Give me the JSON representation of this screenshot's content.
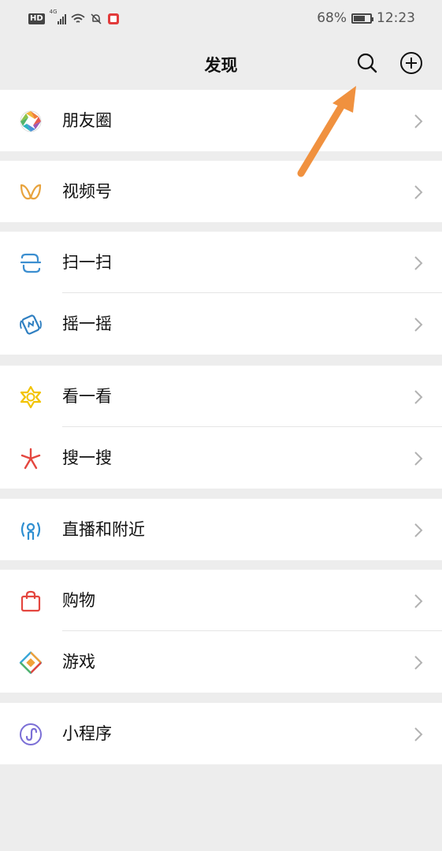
{
  "status_bar": {
    "network_badge": "HD",
    "network_type": "4G",
    "battery_percent": "68%",
    "battery_level": 0.68,
    "time": "12:23"
  },
  "nav": {
    "title": "发现",
    "search_icon": "search-icon",
    "add_icon": "plus-circle-icon"
  },
  "groups": [
    {
      "items": [
        {
          "label": "朋友圈",
          "icon": "moments-icon"
        }
      ]
    },
    {
      "items": [
        {
          "label": "视频号",
          "icon": "channels-icon"
        }
      ]
    },
    {
      "items": [
        {
          "label": "扫一扫",
          "icon": "scan-icon"
        },
        {
          "label": "摇一摇",
          "icon": "shake-icon"
        }
      ]
    },
    {
      "items": [
        {
          "label": "看一看",
          "icon": "top-stories-icon"
        },
        {
          "label": "搜一搜",
          "icon": "search-discover-icon"
        }
      ]
    },
    {
      "items": [
        {
          "label": "直播和附近",
          "icon": "live-nearby-icon"
        }
      ]
    },
    {
      "items": [
        {
          "label": "购物",
          "icon": "shopping-bag-icon"
        },
        {
          "label": "游戏",
          "icon": "games-icon"
        }
      ]
    },
    {
      "items": [
        {
          "label": "小程序",
          "icon": "mini-program-icon"
        }
      ]
    }
  ],
  "colors": {
    "background": "#ededed",
    "row_background": "#ffffff",
    "annotation_arrow": "#f0913f"
  }
}
